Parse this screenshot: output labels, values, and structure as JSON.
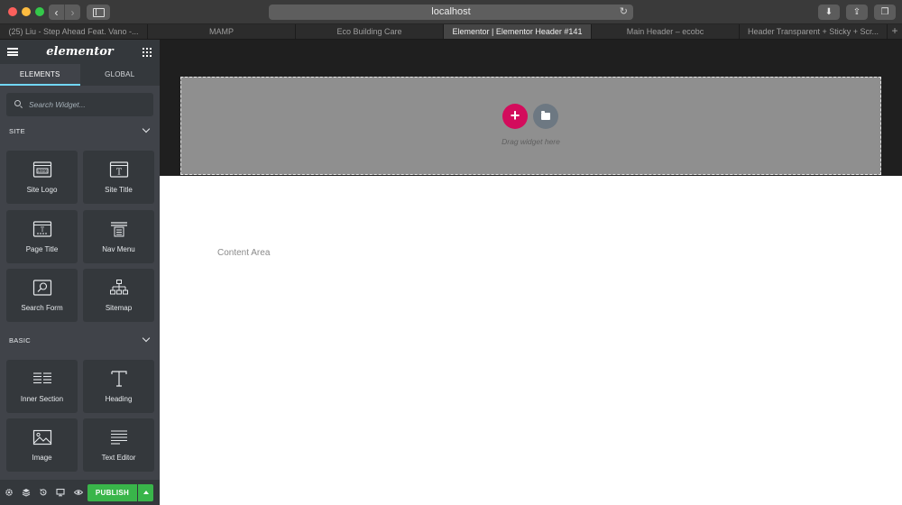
{
  "browser": {
    "url": "localhost",
    "tabs": [
      {
        "label": "(25) Liu - Step Ahead Feat. Vano -...",
        "active": false
      },
      {
        "label": "MAMP",
        "active": false
      },
      {
        "label": "Eco Building Care",
        "active": false
      },
      {
        "label": "Elementor | Elementor Header #141",
        "active": true
      },
      {
        "label": "Main Header – ecobc",
        "active": false
      },
      {
        "label": "Header Transparent + Sticky + Scr...",
        "active": false
      }
    ],
    "new_tab": "+"
  },
  "panel": {
    "logo": "elementor",
    "tabs": {
      "elements": "ELEMENTS",
      "global": "GLOBAL"
    },
    "search_placeholder": "Search Widget...",
    "categories": [
      {
        "title": "SITE",
        "widgets": [
          {
            "label": "Site Logo",
            "icon": "site-logo-icon"
          },
          {
            "label": "Site Title",
            "icon": "site-title-icon"
          },
          {
            "label": "Page Title",
            "icon": "page-title-icon"
          },
          {
            "label": "Nav Menu",
            "icon": "nav-menu-icon"
          },
          {
            "label": "Search Form",
            "icon": "search-form-icon"
          },
          {
            "label": "Sitemap",
            "icon": "sitemap-icon"
          }
        ]
      },
      {
        "title": "BASIC",
        "widgets": [
          {
            "label": "Inner Section",
            "icon": "inner-section-icon"
          },
          {
            "label": "Heading",
            "icon": "heading-icon"
          },
          {
            "label": "Image",
            "icon": "image-icon"
          },
          {
            "label": "Text Editor",
            "icon": "text-editor-icon"
          }
        ]
      }
    ],
    "footer": {
      "publish": "PUBLISH"
    }
  },
  "canvas": {
    "drag_text": "Drag widget here",
    "add_symbol": "+",
    "content_label": "Content Area"
  },
  "colors": {
    "accent_pink": "#d30c5c",
    "publish_green": "#39b54a",
    "tab_underline": "#71d7f7",
    "panel_bg": "#404349"
  }
}
